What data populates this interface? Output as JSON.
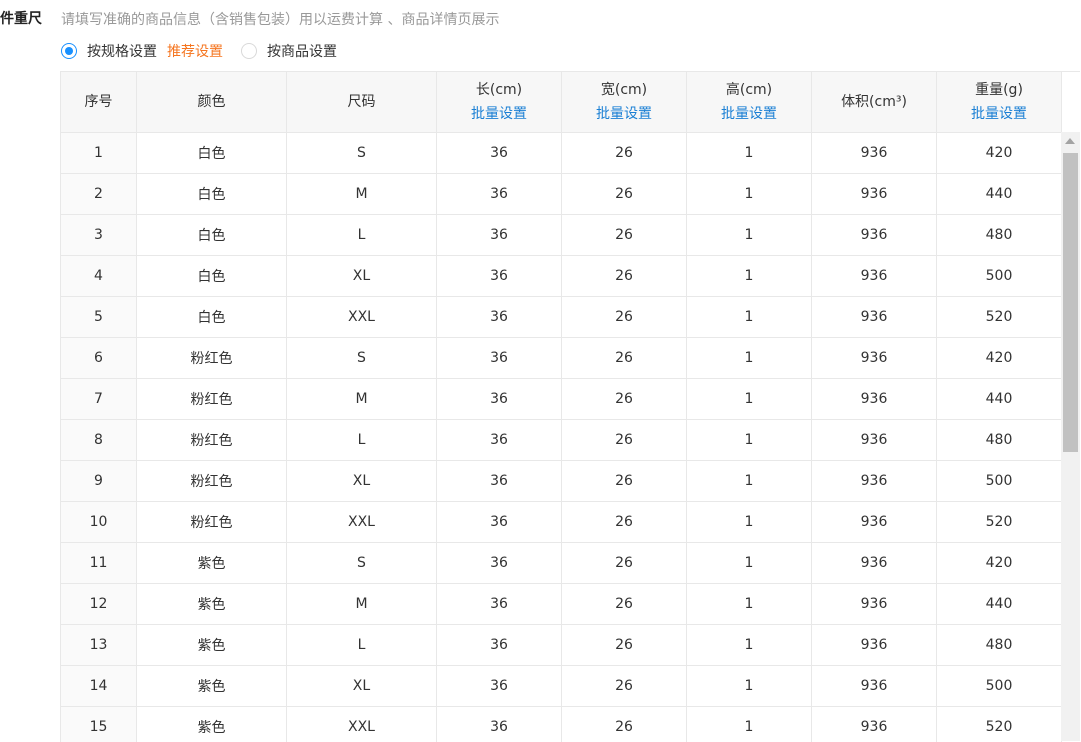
{
  "section": {
    "label": "件重尺",
    "hint": "请填写准确的商品信息（含销售包装）用以运费计算 、商品详情页展示"
  },
  "mode": {
    "options": [
      "按规格设置",
      "按商品设置"
    ],
    "selected": "按规格设置",
    "recommend_tag": "推荐设置"
  },
  "table": {
    "headers": {
      "index": "序号",
      "color": "颜色",
      "size": "尺码",
      "length": "长(cm)",
      "width": "宽(cm)",
      "height": "高(cm)",
      "volume": "体积(cm³)",
      "weight": "重量(g)"
    },
    "batch_label": "批量设置",
    "rows": [
      {
        "index": "1",
        "color": "白色",
        "size": "S",
        "length": "36",
        "width": "26",
        "height": "1",
        "volume": "936",
        "weight": "420"
      },
      {
        "index": "2",
        "color": "白色",
        "size": "M",
        "length": "36",
        "width": "26",
        "height": "1",
        "volume": "936",
        "weight": "440"
      },
      {
        "index": "3",
        "color": "白色",
        "size": "L",
        "length": "36",
        "width": "26",
        "height": "1",
        "volume": "936",
        "weight": "480"
      },
      {
        "index": "4",
        "color": "白色",
        "size": "XL",
        "length": "36",
        "width": "26",
        "height": "1",
        "volume": "936",
        "weight": "500"
      },
      {
        "index": "5",
        "color": "白色",
        "size": "XXL",
        "length": "36",
        "width": "26",
        "height": "1",
        "volume": "936",
        "weight": "520"
      },
      {
        "index": "6",
        "color": "粉红色",
        "size": "S",
        "length": "36",
        "width": "26",
        "height": "1",
        "volume": "936",
        "weight": "420"
      },
      {
        "index": "7",
        "color": "粉红色",
        "size": "M",
        "length": "36",
        "width": "26",
        "height": "1",
        "volume": "936",
        "weight": "440"
      },
      {
        "index": "8",
        "color": "粉红色",
        "size": "L",
        "length": "36",
        "width": "26",
        "height": "1",
        "volume": "936",
        "weight": "480"
      },
      {
        "index": "9",
        "color": "粉红色",
        "size": "XL",
        "length": "36",
        "width": "26",
        "height": "1",
        "volume": "936",
        "weight": "500"
      },
      {
        "index": "10",
        "color": "粉红色",
        "size": "XXL",
        "length": "36",
        "width": "26",
        "height": "1",
        "volume": "936",
        "weight": "520"
      },
      {
        "index": "11",
        "color": "紫色",
        "size": "S",
        "length": "36",
        "width": "26",
        "height": "1",
        "volume": "936",
        "weight": "420"
      },
      {
        "index": "12",
        "color": "紫色",
        "size": "M",
        "length": "36",
        "width": "26",
        "height": "1",
        "volume": "936",
        "weight": "440"
      },
      {
        "index": "13",
        "color": "紫色",
        "size": "L",
        "length": "36",
        "width": "26",
        "height": "1",
        "volume": "936",
        "weight": "480"
      },
      {
        "index": "14",
        "color": "紫色",
        "size": "XL",
        "length": "36",
        "width": "26",
        "height": "1",
        "volume": "936",
        "weight": "500"
      },
      {
        "index": "15",
        "color": "紫色",
        "size": "XXL",
        "length": "36",
        "width": "26",
        "height": "1",
        "volume": "936",
        "weight": "520"
      }
    ]
  },
  "colors": {
    "accent": "#1890ff",
    "link": "#1a7fd4",
    "recommend": "#f5751f",
    "header_bg": "#f7f7f7"
  }
}
